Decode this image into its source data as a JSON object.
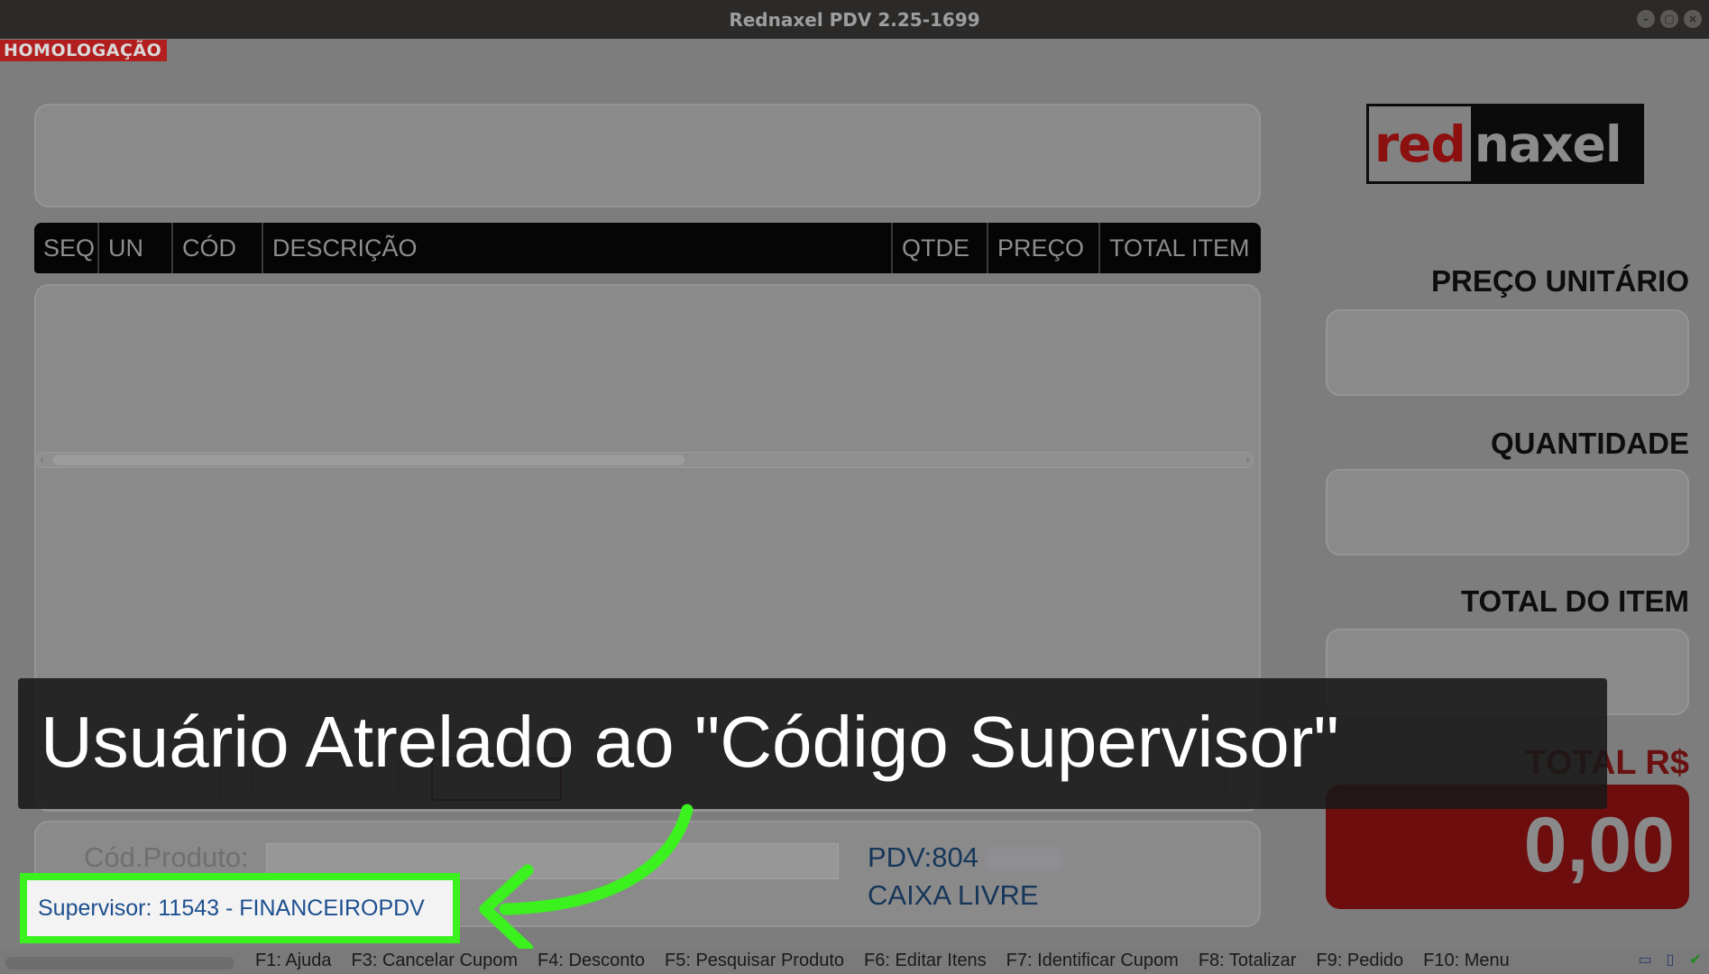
{
  "window": {
    "title": "Rednaxel PDV 2.25-1699",
    "buttons": [
      "minimize",
      "maximize",
      "close"
    ]
  },
  "env_badge": "HOMOLOGAÇÃO",
  "logo": {
    "part1": "red",
    "part2": "naxel"
  },
  "table": {
    "columns": [
      "SEQ",
      "UN",
      "CÓD",
      "DESCRIÇÃO",
      "QTDE",
      "PREÇO",
      "TOTAL ITEM"
    ]
  },
  "right_panel": {
    "preco_label": "PREÇO UNITÁRIO",
    "quantidade_label": "QUANTIDADE",
    "total_item_label": "TOTAL DO ITEM",
    "total_label": "TOTAL R$",
    "total_value": "0,00"
  },
  "bottom": {
    "cod_label": "Cód.Produto:",
    "pdv_line": "PDV:804",
    "status_line": "CAIXA LIVRE",
    "supervisor": "Supervisor: 11543 - FINANCEIROPDV"
  },
  "caption": "Usuário Atrelado ao \"Código Supervisor\"",
  "statusbar": {
    "fkeys": [
      "F1: Ajuda",
      "F3: Cancelar Cupom",
      "F4: Desconto",
      "F5: Pesquisar Produto",
      "F6: Editar Itens",
      "F7: Identificar Cupom",
      "F8: Totalizar",
      "F9: Pedido",
      "F10: Menu"
    ]
  },
  "colors": {
    "highlight_green": "#3bf21f",
    "total_red": "#6e0d0d",
    "badge_red": "#b21d1d"
  },
  "icons": [
    "minimize-icon",
    "maximize-icon",
    "close-icon",
    "window-icon",
    "document-icon",
    "check-icon",
    "curved-arrow-icon"
  ]
}
